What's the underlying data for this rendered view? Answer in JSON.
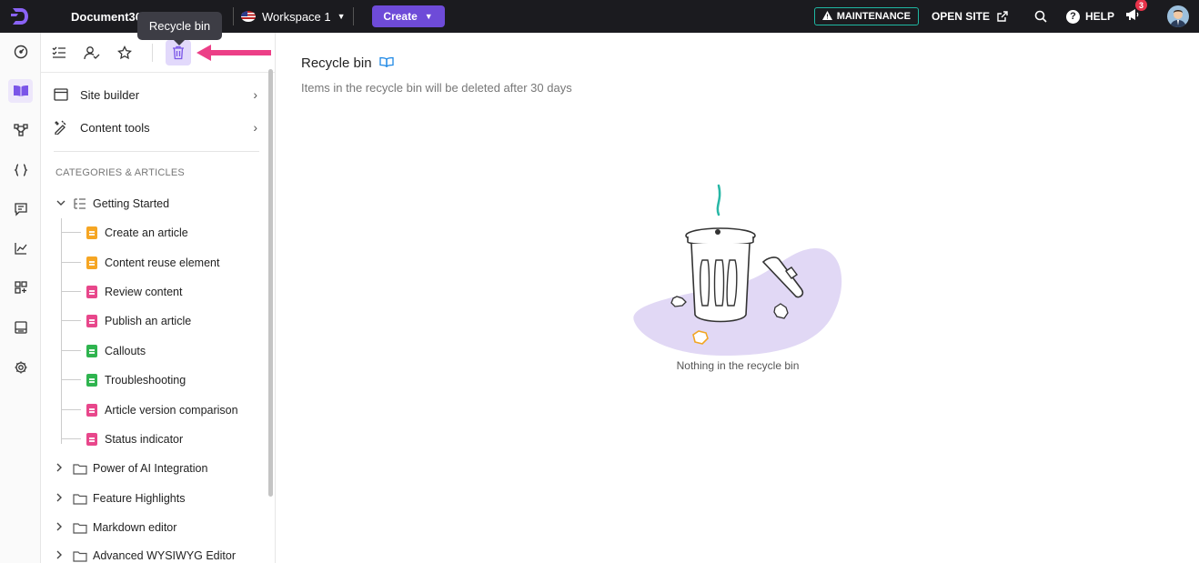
{
  "topbar": {
    "project_name": "Document360 D",
    "workspace": "Workspace 1",
    "create_label": "Create",
    "maintenance_label": "MAINTENANCE",
    "open_site_label": "OPEN SITE",
    "help_label": "HELP",
    "notification_count": "3"
  },
  "tooltip": {
    "text": "Recycle bin"
  },
  "sidebar": {
    "menu": [
      {
        "label": "Site builder"
      },
      {
        "label": "Content tools"
      }
    ],
    "section_title": "CATEGORIES & ARTICLES",
    "tree": {
      "getting_started": "Getting Started",
      "articles": [
        {
          "label": "Create an article",
          "color": "#f6a623"
        },
        {
          "label": "Content reuse element",
          "color": "#f6a623"
        },
        {
          "label": "Review content",
          "color": "#e8478b"
        },
        {
          "label": "Publish an article",
          "color": "#e8478b"
        },
        {
          "label": "Callouts",
          "color": "#2fb44f"
        },
        {
          "label": "Troubleshooting",
          "color": "#2fb44f"
        },
        {
          "label": "Article version comparison",
          "color": "#e8478b"
        },
        {
          "label": "Status indicator",
          "color": "#e8478b"
        }
      ],
      "folders": [
        {
          "label": "Power of AI Integration"
        },
        {
          "label": "Feature Highlights"
        },
        {
          "label": "Markdown editor"
        },
        {
          "label": "Advanced WYSIWYG Editor"
        }
      ]
    }
  },
  "main": {
    "title": "Recycle bin",
    "subtitle": "Items in the recycle bin will be deleted after 30 days",
    "empty_text": "Nothing in the recycle bin"
  },
  "colors": {
    "accent": "#6e4bd8",
    "topbar_bg": "#1b1b1f",
    "maintenance_border": "#1fb8a3",
    "arrow": "#ec3f87",
    "illustration_blob": "#e1d8f5"
  }
}
